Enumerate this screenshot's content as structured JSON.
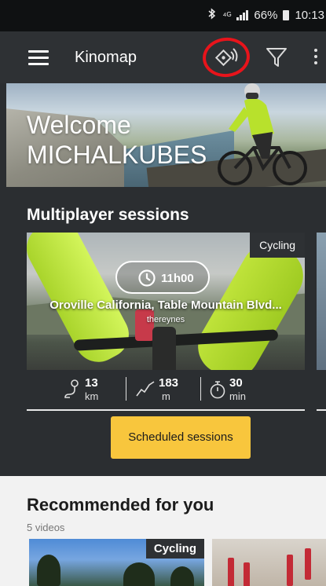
{
  "status_bar": {
    "indicators": "⁴ᴳ",
    "battery": "66%",
    "time": "10:13"
  },
  "app_bar": {
    "title": "Kinomap",
    "icons": [
      "menu-icon",
      "live-session-icon",
      "filter-icon",
      "more-vert-icon"
    ],
    "highlight_color": "#e8141b"
  },
  "hero": {
    "line1": "Welcome",
    "line2": "MICHALKUBES"
  },
  "multiplayer": {
    "title": "Multiplayer sessions",
    "card": {
      "sport_tag": "Cycling",
      "start_time": "11h00",
      "route_title": "Oroville California, Table Mountain Blvd...",
      "author": "thereynes",
      "distance_value": "13",
      "distance_unit": "km",
      "elevation_value": "183",
      "elevation_unit": "m",
      "duration_value": "30",
      "duration_unit": "min"
    },
    "scheduled_button": "Scheduled sessions"
  },
  "recommended": {
    "title": "Recommended for you",
    "count": "5 videos",
    "items": [
      {
        "sport_tag": "Cycling"
      }
    ]
  },
  "colors": {
    "background": "#2b2e31",
    "accent": "#f8c63d",
    "light_section": "#f2f2f2"
  }
}
